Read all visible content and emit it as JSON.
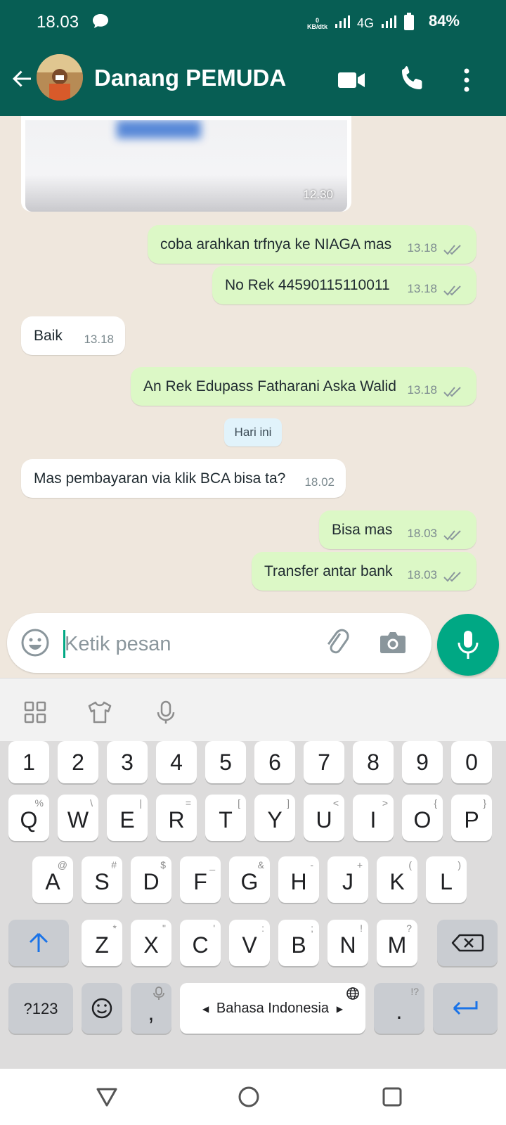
{
  "status_bar": {
    "time": "18.03",
    "speed_value": "0",
    "speed_unit": "KB/dtk",
    "network": "4G",
    "battery": "84%"
  },
  "header": {
    "contact_name": "Danang PEMUDA"
  },
  "messages": [
    {
      "text": "coba arahkan trfnya ke NIAGA mas",
      "time": "13.18"
    },
    {
      "text": "No Rek 44590115110011",
      "time": "13.18"
    },
    {
      "text": "Baik",
      "time": "13.18"
    },
    {
      "text": "An Rek Edupass Fatharani Aska Walid",
      "time": "13.18"
    },
    {
      "text": "Mas pembayaran via klik BCA bisa ta?",
      "time": "18.02"
    },
    {
      "text": "Bisa mas",
      "time": "18.03"
    },
    {
      "text": "Transfer antar bank",
      "time": "18.03"
    }
  ],
  "image_message": {
    "time": "12.30"
  },
  "date_chip": "Hari ini",
  "composer": {
    "placeholder": "Ketik pesan"
  },
  "keyboard": {
    "numbers": [
      "1",
      "2",
      "3",
      "4",
      "5",
      "6",
      "7",
      "8",
      "9",
      "0"
    ],
    "row1": [
      [
        "Q",
        "%"
      ],
      [
        "W",
        "\\"
      ],
      [
        "E",
        "|"
      ],
      [
        "R",
        "="
      ],
      [
        "T",
        "["
      ],
      [
        "Y",
        "]"
      ],
      [
        "U",
        "<"
      ],
      [
        "I",
        ">"
      ],
      [
        "O",
        "{"
      ],
      [
        "P",
        "}"
      ]
    ],
    "row2": [
      [
        "A",
        "@"
      ],
      [
        "S",
        "#"
      ],
      [
        "D",
        "$"
      ],
      [
        "F",
        "_"
      ],
      [
        "G",
        "&"
      ],
      [
        "H",
        "-"
      ],
      [
        "J",
        "+"
      ],
      [
        "K",
        "("
      ],
      [
        "L",
        ")"
      ]
    ],
    "row3": [
      [
        "Z",
        "*"
      ],
      [
        "X",
        "\""
      ],
      [
        "C",
        "'"
      ],
      [
        "V",
        ":"
      ],
      [
        "B",
        ";"
      ],
      [
        "N",
        "!"
      ],
      [
        "M",
        "?"
      ]
    ],
    "symbols_label": "?123",
    "comma": ",",
    "space_label": "Bahasa Indonesia",
    "period": ".",
    "period_sub": "!?"
  },
  "colors": {
    "header": "#075e54",
    "outgoing": "#dcf8c6",
    "accent": "#00a884"
  }
}
